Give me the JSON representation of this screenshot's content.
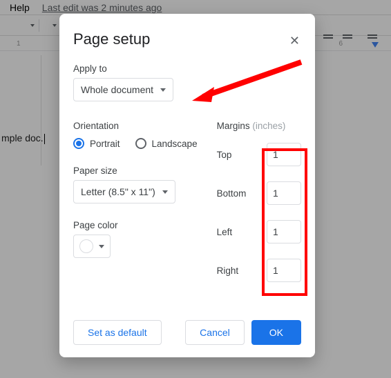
{
  "menubar": {
    "help": "Help",
    "last_edit": "Last edit was 2 minutes ago"
  },
  "ruler": {
    "n1": "1",
    "n6": "6"
  },
  "doc_text": "mple doc.",
  "dialog": {
    "title": "Page setup",
    "apply_to": {
      "label": "Apply to",
      "value": "Whole document"
    },
    "orientation": {
      "label": "Orientation",
      "portrait": "Portrait",
      "landscape": "Landscape",
      "selected": "portrait"
    },
    "paper_size": {
      "label": "Paper size",
      "value": "Letter (8.5\" x 11\")"
    },
    "page_color": {
      "label": "Page color"
    },
    "margins": {
      "label": "Margins",
      "unit": "(inches)",
      "top_label": "Top",
      "top": "1",
      "bottom_label": "Bottom",
      "bottom": "1",
      "left_label": "Left",
      "left": "1",
      "right_label": "Right",
      "right": "1"
    },
    "buttons": {
      "set_default": "Set as default",
      "cancel": "Cancel",
      "ok": "OK"
    }
  }
}
